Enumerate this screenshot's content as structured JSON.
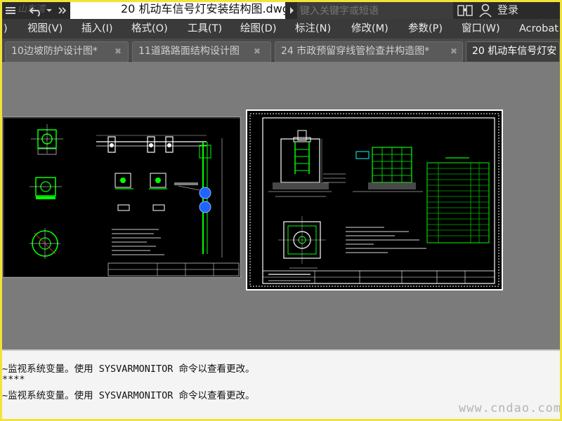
{
  "titlebar": {
    "logo_text": "山东湾",
    "doc_title": "20 机动车信号灯安装结构图.dwg",
    "search_placeholder": "键入关键字或短语",
    "login_label": "登录"
  },
  "menubar": {
    "items": [
      "视图(V)",
      "插入(I)",
      "格式(O)",
      "工具(T)",
      "绘图(D)",
      "标注(N)",
      "修改(M)",
      "参数(P)",
      "窗口(W)",
      "Acrobat"
    ],
    "lead": ")"
  },
  "tabs": [
    {
      "label": "10边坡防护设计图*"
    },
    {
      "label": "11道路路面结构设计图"
    },
    {
      "label": "24 市政预留穿线管检查井构造图*"
    },
    {
      "label": "20 机动车信号灯安"
    }
  ],
  "command_line": {
    "lines": [
      "~监视系统变量。使用 SYSVARMONITOR 命令以查看更改。",
      "****",
      "~监视系统变量。使用 SYSVARMONITOR 命令以查看更改。"
    ],
    "watermark": "www.cndao.com"
  },
  "colors": {
    "accent_yellow": "#f2e33a",
    "drawing_green": "#00ff00",
    "drawing_white": "#ffffff",
    "drawing_blue": "#1e64ff"
  }
}
